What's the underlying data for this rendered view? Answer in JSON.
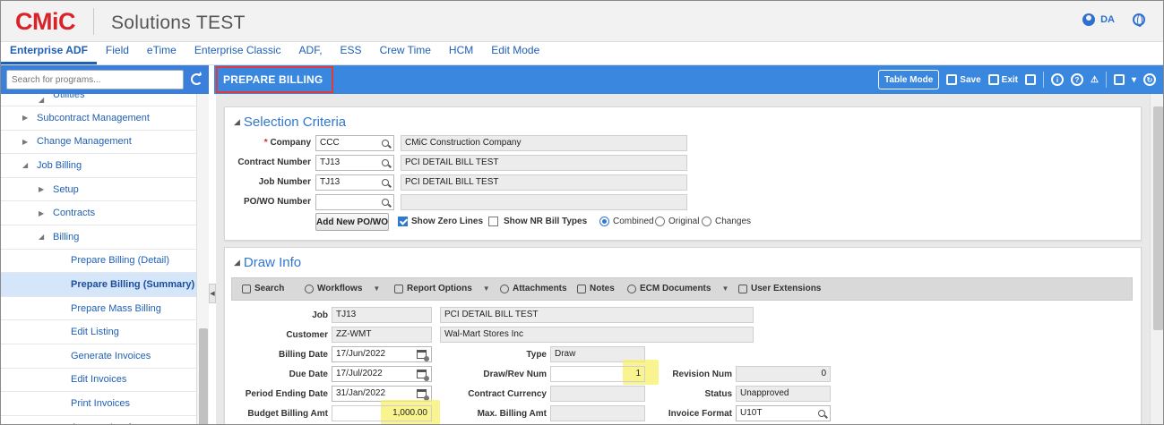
{
  "header": {
    "logo_text": "CMiC",
    "app_title": "Solutions TEST",
    "user_initials": "DA"
  },
  "tabs": [
    {
      "label": "Enterprise ADF",
      "active": true
    },
    {
      "label": "Field"
    },
    {
      "label": "eTime"
    },
    {
      "label": "Enterprise Classic"
    },
    {
      "label": "ADF,"
    },
    {
      "label": "ESS"
    },
    {
      "label": "Crew Time"
    },
    {
      "label": "HCM"
    },
    {
      "label": "Edit Mode"
    }
  ],
  "sidebar": {
    "search_placeholder": "Search for programs...",
    "items": [
      {
        "label": "Utilities",
        "indent": 2,
        "tri": "◢"
      },
      {
        "label": "Subcontract Management",
        "indent": 1,
        "tri": "▶"
      },
      {
        "label": "Change Management",
        "indent": 1,
        "tri": "▶"
      },
      {
        "label": "Job Billing",
        "indent": 1,
        "tri": "◢"
      },
      {
        "label": "Setup",
        "indent": 2,
        "tri": "▶"
      },
      {
        "label": "Contracts",
        "indent": 2,
        "tri": "▶"
      },
      {
        "label": "Billing",
        "indent": 2,
        "tri": "◢"
      },
      {
        "label": "Prepare Billing (Detail)",
        "indent": 4
      },
      {
        "label": "Prepare Billing (Summary)",
        "indent": 4,
        "active": true
      },
      {
        "label": "Prepare Mass Billing",
        "indent": 4
      },
      {
        "label": "Edit Listing",
        "indent": 4
      },
      {
        "label": "Generate Invoices",
        "indent": 4
      },
      {
        "label": "Edit Invoices",
        "indent": 4
      },
      {
        "label": "Print Invoices",
        "indent": 4
      },
      {
        "label": "Approve Invoice",
        "indent": 4
      }
    ]
  },
  "titlebar": {
    "page_title": "PREPARE BILLING",
    "table_mode": "Table Mode",
    "save": "Save",
    "exit": "Exit"
  },
  "selection": {
    "title": "Selection Criteria",
    "company_label": "Company",
    "company_value": "CCC",
    "company_name": "CMiC Construction Company",
    "contract_label": "Contract Number",
    "contract_value": "TJ13",
    "contract_name": "PCI DETAIL BILL TEST",
    "job_label": "Job Number",
    "job_value": "TJ13",
    "job_name": "PCI DETAIL BILL TEST",
    "powo_label": "PO/WO Number",
    "powo_value": "",
    "add_powo": "Add New PO/WO",
    "show_zero": "Show Zero Lines",
    "show_nr": "Show NR Bill Types",
    "radio_combined": "Combined",
    "radio_original": "Original",
    "radio_changes": "Changes"
  },
  "draw": {
    "title": "Draw Info",
    "toolbar": {
      "search": "Search",
      "workflows": "Workflows",
      "report_options": "Report Options",
      "attachments": "Attachments",
      "notes": "Notes",
      "ecm": "ECM Documents",
      "user_ext": "User Extensions"
    },
    "job_label": "Job",
    "job_value": "TJ13",
    "job_name": "PCI DETAIL BILL TEST",
    "customer_label": "Customer",
    "customer_value": "ZZ-WMT",
    "customer_name": "Wal-Mart Stores Inc",
    "billing_date_label": "Billing Date",
    "billing_date": "17/Jun/2022",
    "type_label": "Type",
    "type_value": "Draw",
    "due_date_label": "Due Date",
    "due_date": "17/Jul/2022",
    "draw_rev_label": "Draw/Rev Num",
    "draw_rev_value": "1",
    "revision_label": "Revision Num",
    "revision_value": "0",
    "period_label": "Period Ending Date",
    "period_value": "31/Jan/2022",
    "currency_label": "Contract Currency",
    "currency_value": "",
    "status_label": "Status",
    "status_value": "Unapproved",
    "budget_label": "Budget Billing Amt",
    "budget_value": "1,000.00",
    "max_label": "Max. Billing Amt",
    "max_value": "",
    "invoice_format_label": "Invoice Format",
    "invoice_format_value": "U10T"
  }
}
